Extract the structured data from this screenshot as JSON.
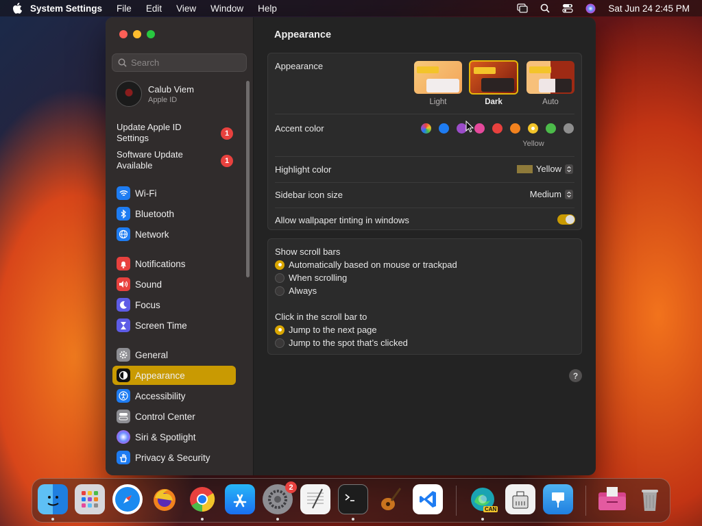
{
  "menubar": {
    "app": "System Settings",
    "menus": [
      "File",
      "Edit",
      "View",
      "Window",
      "Help"
    ],
    "clock": "Sat Jun 24  2:45 PM"
  },
  "sidebar": {
    "search_placeholder": "Search",
    "user": {
      "name": "Calub Viem",
      "subtitle": "Apple ID"
    },
    "updates": [
      {
        "label": "Update Apple ID Settings",
        "badge": "1"
      },
      {
        "label": "Software Update Available",
        "badge": "1"
      }
    ],
    "items": [
      {
        "label": "Wi-Fi",
        "icon": "wifi-icon",
        "color": "#1e7cf2"
      },
      {
        "label": "Bluetooth",
        "icon": "bluetooth-icon",
        "color": "#1e7cf2"
      },
      {
        "label": "Network",
        "icon": "globe-icon",
        "color": "#1e7cf2"
      },
      {
        "label": "Notifications",
        "icon": "bell-icon",
        "color": "#e8413e"
      },
      {
        "label": "Sound",
        "icon": "speaker-icon",
        "color": "#e8413e"
      },
      {
        "label": "Focus",
        "icon": "moon-icon",
        "color": "#5e5ce6"
      },
      {
        "label": "Screen Time",
        "icon": "hourglass-icon",
        "color": "#5e5ce6"
      },
      {
        "label": "General",
        "icon": "gear-icon",
        "color": "#8e8e93"
      },
      {
        "label": "Appearance",
        "icon": "appearance-icon",
        "color": "#111111",
        "selected": true
      },
      {
        "label": "Accessibility",
        "icon": "accessibility-icon",
        "color": "#1e7cf2"
      },
      {
        "label": "Control Center",
        "icon": "control-center-icon",
        "color": "#8e8e93"
      },
      {
        "label": "Siri & Spotlight",
        "icon": "siri-icon",
        "color": "#b44ae0"
      },
      {
        "label": "Privacy & Security",
        "icon": "hand-icon",
        "color": "#1e7cf2"
      }
    ]
  },
  "content": {
    "title": "Appearance",
    "appearance_label": "Appearance",
    "modes": [
      {
        "label": "Light",
        "selected": false
      },
      {
        "label": "Dark",
        "selected": true
      },
      {
        "label": "Auto",
        "selected": false
      }
    ],
    "accent_label": "Accent color",
    "accent_colors": [
      "multicolor",
      "#1e7cf2",
      "#9b4dc9",
      "#e5499c",
      "#e8413e",
      "#f2821e",
      "#f2c42a",
      "#4cbb4a",
      "#8e8e8e"
    ],
    "accent_selected_name": "Yellow",
    "highlight_label": "Highlight color",
    "highlight_value": "Yellow",
    "highlight_swatch": "#8e7a3a",
    "icon_size_label": "Sidebar icon size",
    "icon_size_value": "Medium",
    "tinting_label": "Allow wallpaper tinting in windows",
    "tinting_on": true,
    "scroll_title": "Show scroll bars",
    "scroll_options": [
      {
        "label": "Automatically based on mouse or trackpad",
        "selected": true
      },
      {
        "label": "When scrolling",
        "selected": false
      },
      {
        "label": "Always",
        "selected": false
      }
    ],
    "click_title": "Click in the scroll bar to",
    "click_options": [
      {
        "label": "Jump to the next page",
        "selected": true
      },
      {
        "label": "Jump to the spot that’s clicked",
        "selected": false
      }
    ],
    "help": "?"
  },
  "dock": {
    "apps": [
      "Finder",
      "Launchpad",
      "Safari",
      "Firefox",
      "Chrome",
      "App Store",
      "System Settings",
      "TextEdit",
      "Terminal",
      "GarageBand",
      "VS Code",
      "Edge Canary",
      "Archive Utility",
      "Keynote",
      "Downloads",
      "Trash"
    ],
    "settings_badge": "2",
    "edge_label": "CAN"
  }
}
